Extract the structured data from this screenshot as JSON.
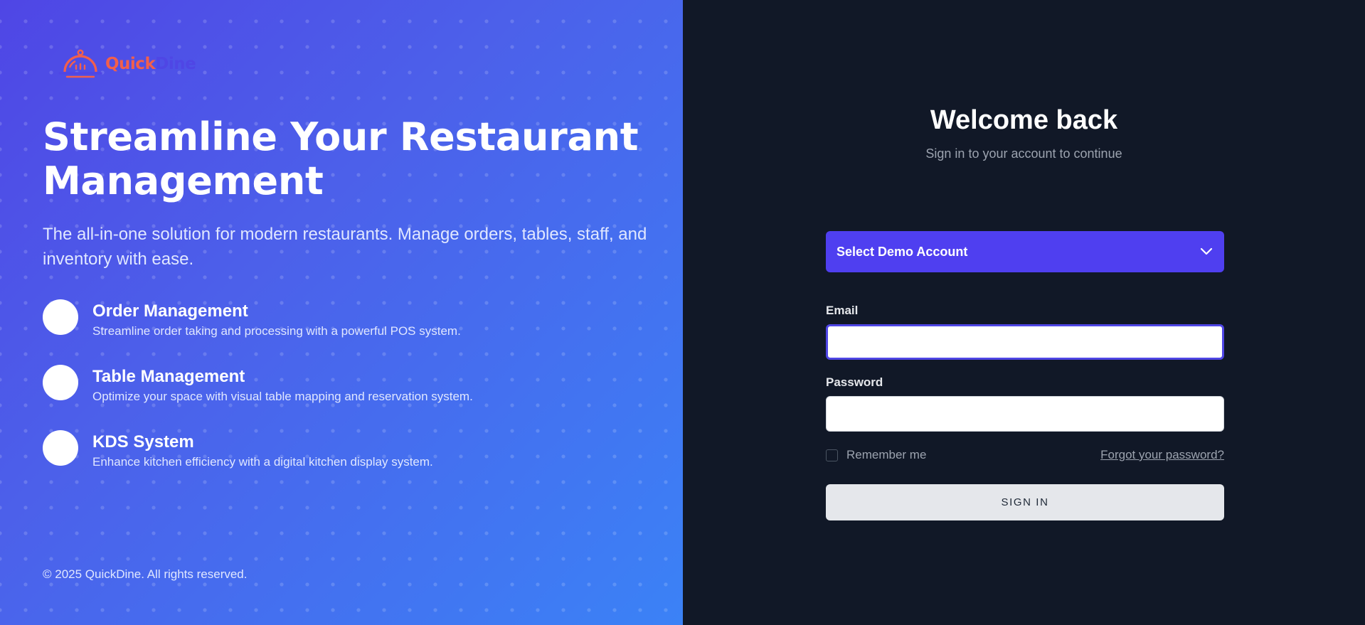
{
  "brand": {
    "name_part1": "Quick",
    "name_part2": "Dine",
    "colors": {
      "primary": "#4f46e5",
      "accent": "#f25f4c"
    }
  },
  "hero": {
    "headline": "Streamline Your Restaurant Management",
    "tagline": "The all-in-one solution for modern restaurants. Manage orders, tables, staff, and inventory with ease.",
    "features": [
      {
        "title": "Order Management",
        "description": "Streamline order taking and processing with a powerful POS system."
      },
      {
        "title": "Table Management",
        "description": "Optimize your space with visual table mapping and reservation system."
      },
      {
        "title": "KDS System",
        "description": "Enhance kitchen efficiency with a digital kitchen display system."
      }
    ],
    "copyright": "© 2025 QuickDine. All rights reserved."
  },
  "login": {
    "title": "Welcome back",
    "subtitle": "Sign in to your account to continue",
    "demo_select": {
      "label": "Select Demo Account",
      "icon": "chevron-down-icon"
    },
    "email": {
      "label": "Email",
      "value": ""
    },
    "password": {
      "label": "Password",
      "value": ""
    },
    "remember_label": "Remember me",
    "forgot_label": "Forgot your password?",
    "submit_label": "SIGN IN"
  }
}
